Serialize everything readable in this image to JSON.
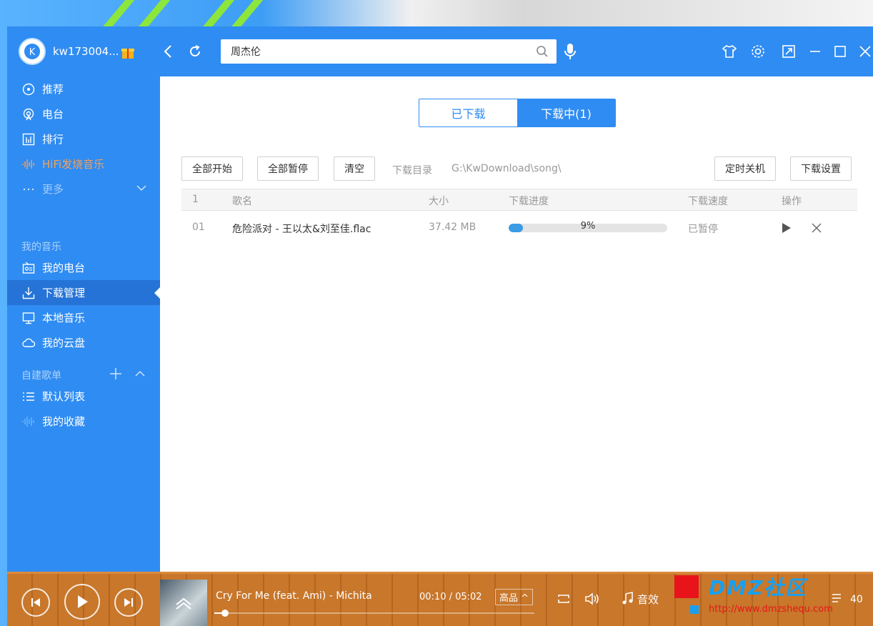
{
  "app": {
    "username": "kw173004...",
    "search": {
      "value": "周杰伦",
      "placeholder": ""
    }
  },
  "sidebar": {
    "items": [
      {
        "label": "推荐",
        "icon": "disc-icon"
      },
      {
        "label": "电台",
        "icon": "radio-icon"
      },
      {
        "label": "排行",
        "icon": "chart-icon"
      },
      {
        "label": "HiFi发烧音乐",
        "icon": "waveform-icon"
      },
      {
        "label": "更多",
        "icon": "dots-icon"
      }
    ],
    "my_music_title": "我的音乐",
    "my_music": [
      {
        "label": "我的电台",
        "icon": "my-radio-icon"
      },
      {
        "label": "下载管理",
        "icon": "download-icon"
      },
      {
        "label": "本地音乐",
        "icon": "monitor-icon"
      },
      {
        "label": "我的云盘",
        "icon": "cloud-icon"
      }
    ],
    "playlists_title": "自建歌单",
    "playlists": [
      {
        "label": "默认列表",
        "icon": "list-icon"
      },
      {
        "label": "我的收藏",
        "icon": "heart-wave-icon"
      }
    ]
  },
  "content": {
    "tabs": [
      {
        "label": "已下载",
        "active": false
      },
      {
        "label": "下载中(1)",
        "active": true
      }
    ],
    "toolbar": {
      "start_all": "全部开始",
      "pause_all": "全部暂停",
      "clear": "清空",
      "dir_label": "下载目录",
      "dir_path": "G:\\KwDownload\\song\\",
      "timer_shutdown": "定时关机",
      "download_settings": "下载设置"
    },
    "table": {
      "headers": {
        "index": "1",
        "name": "歌名",
        "size": "大小",
        "progress": "下载进度",
        "speed": "下载速度",
        "actions": "操作"
      },
      "rows": [
        {
          "index": "01",
          "name": "危险派对 - 王以太&刘至佳.flac",
          "size": "37.42 MB",
          "progress_text": "9%",
          "progress_value": 0.09,
          "status": "已暂停"
        }
      ]
    }
  },
  "player": {
    "track_title": "Cry For Me (feat. Ami) - Michita",
    "time": "00:10 / 05:02",
    "quality": "高品 ^",
    "seek_fraction": 0.033,
    "effects_label": "音效",
    "volume_count": "40"
  },
  "watermark": {
    "text": "DMZ社区",
    "url": "http://www.dmzshequ.com"
  },
  "colors": {
    "brand_blue": "#2f8cf2",
    "sidebar_active": "#2573d6",
    "progress_fill": "#3b9be5",
    "hifi_orange": "#f2a25e"
  }
}
